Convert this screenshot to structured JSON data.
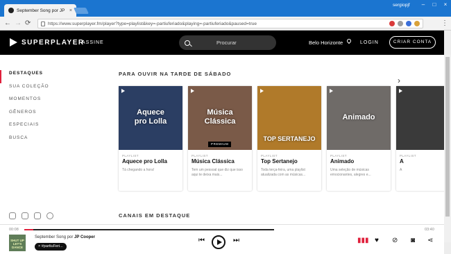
{
  "browser": {
    "tab_title": "September Song por JP",
    "tab_close": "×",
    "user": "sergiopjf",
    "window_buttons": [
      "–",
      "□",
      "×"
    ],
    "nav": {
      "back": "←",
      "forward": "→",
      "reload": "⟳"
    },
    "url": "https://www.superplayer.fm/player?type=playlist&key=-partiuferiado&playing=-partiuferiado&paused=true",
    "menu": "⋮",
    "colors": {
      "titlebar": "#1b75d0",
      "accent": "#e0203c"
    }
  },
  "header": {
    "logo": "SUPERPLAYER",
    "assine": "ASSINE",
    "search_placeholder": "Procurar",
    "city": "Belo Horizonte",
    "login": "LOGIN",
    "cta": "CRIAR CONTA"
  },
  "sidebar": {
    "items": [
      {
        "label": "DESTAQUES",
        "active": true
      },
      {
        "label": "SUA COLEÇÃO",
        "active": false
      },
      {
        "label": "MOMENTOS",
        "active": false
      },
      {
        "label": "GÊNEROS",
        "active": false
      },
      {
        "label": "ESPECIAIS",
        "active": false
      },
      {
        "label": "BUSCA",
        "active": false
      }
    ],
    "social_icons": [
      "facebook-icon",
      "twitter-icon",
      "instagram-icon",
      "wordpress-icon"
    ]
  },
  "main": {
    "section_title": "PARA OUVIR NA TARDE DE SÁBADO",
    "next_arrow": "›",
    "cards": [
      {
        "overlay": "Aquece\npro Lolla",
        "badge": "",
        "kind": "PLAYLIST",
        "title": "Aquece pro Lolla",
        "desc": "Tá chegando a hora!",
        "bg": "#2b3e63"
      },
      {
        "overlay": "Música\nClássica",
        "badge": "PREMIUM",
        "kind": "PLAYLIST",
        "title": "Música Clássica",
        "desc": "Tem um pessoal que diz que isso aqui te deixa mais...",
        "bg": "#7a5a48"
      },
      {
        "overlay": "TOP SERTANEJO",
        "badge": "",
        "kind": "PLAYLIST",
        "title": "Top Sertanejo",
        "desc": "Toda terça-feira, uma playlist atualizada com as músicas...",
        "bg": "#b07a2a"
      },
      {
        "overlay": "Animado",
        "badge": "",
        "kind": "PLAYLIST",
        "title": "Animado",
        "desc": "Uma seleção de músicas emocionantes, alegres e...",
        "bg": "#6f6b68"
      },
      {
        "overlay": "",
        "badge": "",
        "kind": "PLAYLIST",
        "title": "A",
        "desc": "A",
        "bg": "#3a3a3a"
      }
    ],
    "channels_title": "CANAIS EM DESTAQUE"
  },
  "player": {
    "time_current": "00:08",
    "time_total": "03:40",
    "progress_fraction": 0.036,
    "cover_text": "SHUT UP\nLET'S DANCE",
    "song": "September Song",
    "by": "por",
    "artist": "JP Cooper",
    "tag": "#partiuFeri...",
    "tag_close": "×",
    "controls": {
      "prev": "⏮",
      "next": "⏭"
    },
    "right_icons": [
      "volume-icon",
      "heart-icon",
      "dislike-icon",
      "radio-icon",
      "share-icon"
    ]
  }
}
